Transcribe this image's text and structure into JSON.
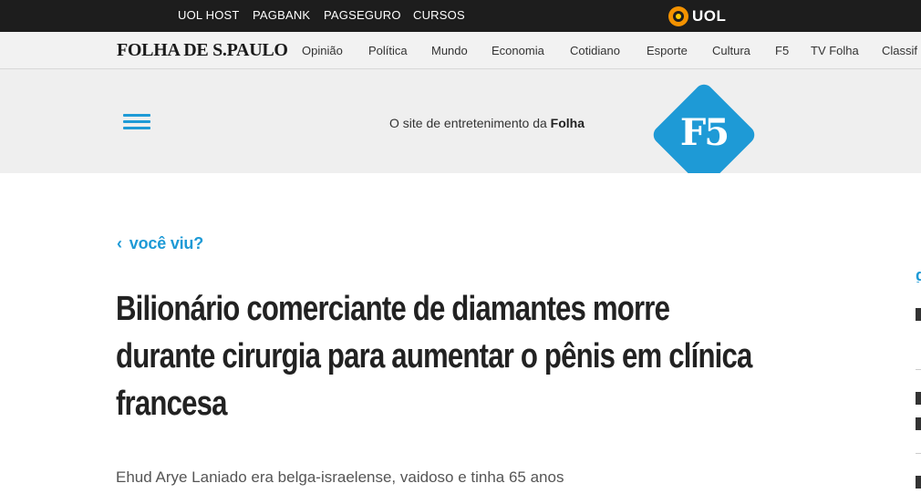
{
  "uol_bar": {
    "links": [
      "UOL HOST",
      "PAGBANK",
      "PAGSEGURO",
      "CURSOS"
    ],
    "logo_text": "UOL"
  },
  "folha_nav": {
    "logo": "FOLHA DE S.PAULO",
    "sections": [
      "Opinião",
      "Política",
      "Mundo",
      "Economia",
      "Cotidiano",
      "Esporte",
      "Cultura",
      "F5",
      "TV Folha",
      "Classif"
    ]
  },
  "f5_header": {
    "menu_icon": "hamburger-menu-icon",
    "tagline_prefix": "O site de entretenimento da ",
    "tagline_brand": "Folha",
    "logo_text": "F5",
    "accent_color": "#1e9ad6"
  },
  "article": {
    "kicker": "você viu?",
    "headline_lines": [
      "Bilionário comerciante de diamantes morre",
      "durante cirurgia para aumentar o pênis em clínica",
      "francesa"
    ],
    "subheadline": "Ehud Arye Laniado era belga-israelense, vaidoso e tinha 65 anos"
  },
  "sidebar_edge": {
    "glyph": "g"
  }
}
